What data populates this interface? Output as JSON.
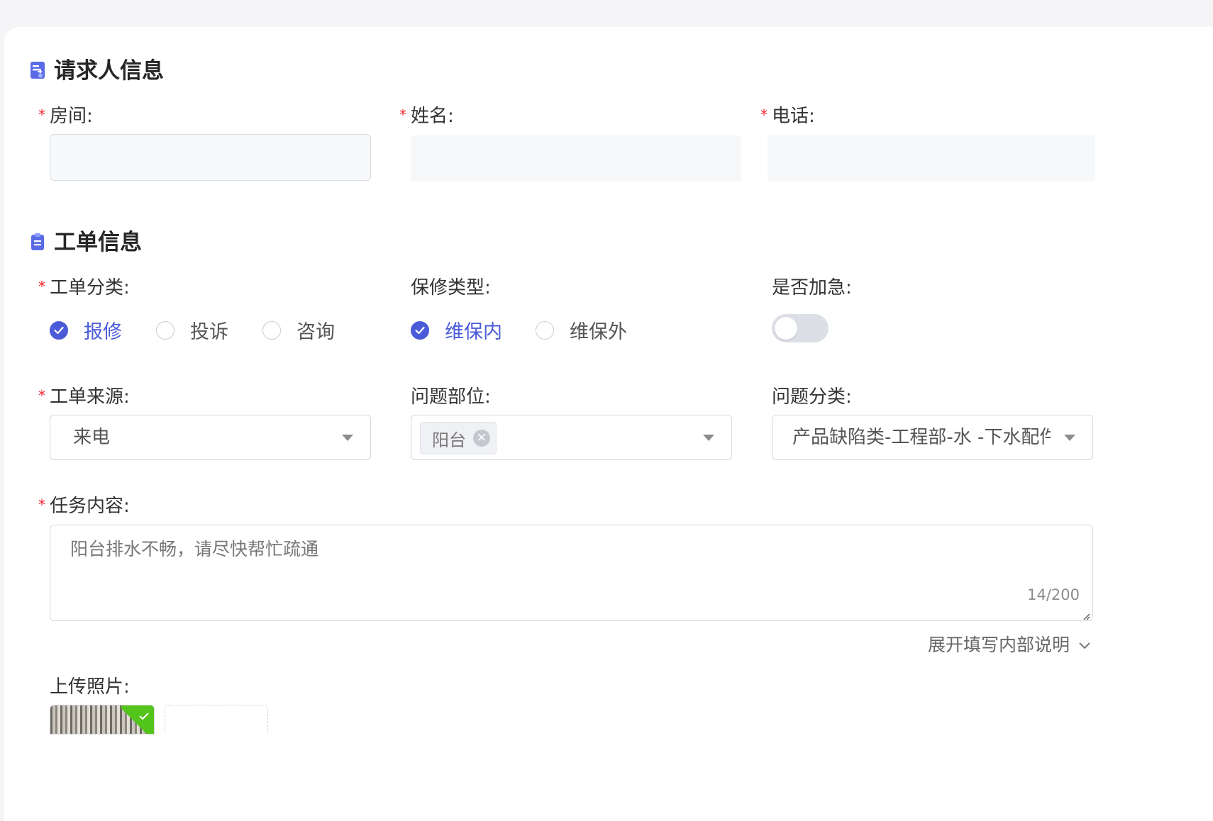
{
  "requester": {
    "section_title": "请求人信息",
    "room_label": "房间:",
    "name_label": "姓名:",
    "phone_label": "电话:",
    "room_value": "",
    "name_value": "",
    "phone_value": ""
  },
  "ticket": {
    "section_title": "工单信息",
    "category_label": "工单分类:",
    "category_options": [
      "报修",
      "投诉",
      "咨询"
    ],
    "category_selected": "报修",
    "warranty_label": "保修类型:",
    "warranty_options": [
      "维保内",
      "维保外"
    ],
    "warranty_selected": "维保内",
    "urgent_label": "是否加急:",
    "urgent_on": false,
    "source_label": "工单来源:",
    "source_value": "来电",
    "location_label": "问题部位:",
    "location_tag": "阳台",
    "problem_category_label": "问题分类:",
    "problem_category_value": "产品缺陷类-工程部-水 -下水配件",
    "task_label": "任务内容:",
    "task_content": "阳台排水不畅，请尽快帮忙疏通",
    "task_counter": "14/200",
    "expand_link": "展开填写内部说明",
    "upload_label": "上传照片:"
  },
  "colors": {
    "primary": "#4a5bd8",
    "required": "#f5222d",
    "success": "#52c41a"
  }
}
